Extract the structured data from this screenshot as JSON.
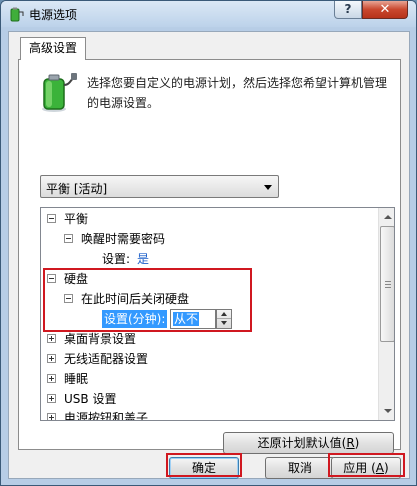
{
  "window": {
    "title": "电源选项",
    "help_label": "?",
    "close_label": "✕"
  },
  "tabs": [
    {
      "label": "高级设置",
      "selected": true
    }
  ],
  "instructions": "选择您要自定义的电源计划，然后选择您希望计算机管理的电源设置。",
  "plan_select": {
    "value": "平衡 [活动]"
  },
  "tree": {
    "items": [
      {
        "label": "平衡",
        "expanded": true
      },
      {
        "label": "唤醒时需要密码",
        "expanded": true
      },
      {
        "setting_label": "设置:",
        "setting_value": "是"
      },
      {
        "label": "硬盘",
        "expanded": true
      },
      {
        "label": "在此时间后关闭硬盘",
        "expanded": true
      },
      {
        "setting_label": "设置(分钟):",
        "setting_value": "从不"
      },
      {
        "label": "桌面背景设置",
        "expanded": false
      },
      {
        "label": "无线适配器设置",
        "expanded": false
      },
      {
        "label": "睡眠",
        "expanded": false
      },
      {
        "label": "USB 设置",
        "expanded": false
      },
      {
        "label": "电源按钮和盖子",
        "expanded": false
      }
    ]
  },
  "buttons": {
    "restore_prefix": "还原计划默认值(",
    "restore_key": "R",
    "restore_suffix": ")",
    "ok": "确定",
    "cancel": "取消",
    "apply_prefix": "应用 (",
    "apply_key": "A",
    "apply_suffix": ")"
  },
  "colors": {
    "highlight_border": "#d01820",
    "selection": "#3399ff",
    "link_value": "#1a5ec9"
  }
}
